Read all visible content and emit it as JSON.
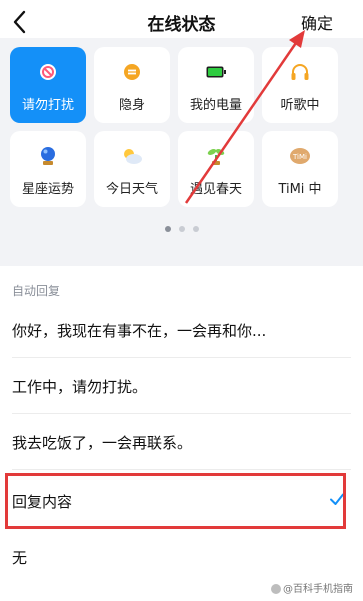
{
  "header": {
    "title": "在线状态",
    "confirm_label": "确定"
  },
  "status_tiles": [
    {
      "label": "请勿打扰",
      "icon": "do-not-disturb-icon",
      "active": true
    },
    {
      "label": "隐身",
      "icon": "invisible-icon",
      "active": false
    },
    {
      "label": "我的电量",
      "icon": "battery-icon",
      "active": false
    },
    {
      "label": "听歌中",
      "icon": "headphones-icon",
      "active": false
    },
    {
      "label": "星座运势",
      "icon": "crystal-ball-icon",
      "active": false
    },
    {
      "label": "今日天气",
      "icon": "weather-icon",
      "active": false
    },
    {
      "label": "遇见春天",
      "icon": "sprout-icon",
      "active": false
    },
    {
      "label": "TiMi 中",
      "icon": "timi-icon",
      "active": false
    }
  ],
  "icon_badges": {
    "timi": "TiMi"
  },
  "auto_reply": {
    "section_label": "自动回复",
    "options": [
      "你好，我现在有事不在，一会再和你...",
      "工作中，请勿打扰。",
      "我去吃饭了，一会再联系。",
      "回复内容",
      "无"
    ],
    "selected_index": 3
  },
  "watermark": "@百科手机指南",
  "colors": {
    "accent": "#1490f8",
    "annotation": "#e23a3a",
    "panel_bg": "#f2f3f6"
  }
}
